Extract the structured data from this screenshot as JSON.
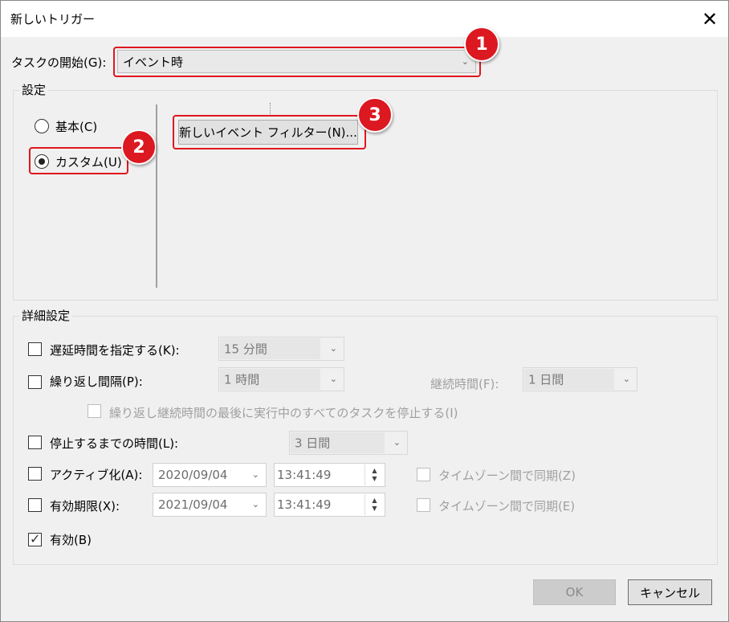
{
  "window": {
    "title": "新しいトリガー",
    "close_glyph": "✕"
  },
  "task_start": {
    "label": "タスクの開始(G):",
    "value": "イベント時",
    "arrow": "⌄"
  },
  "settings": {
    "group_title": "設定",
    "radio_basic": "基本(C)",
    "radio_custom": "カスタム(U)",
    "selected": "custom",
    "filter_button": "新しいイベント フィルター(N)..."
  },
  "advanced": {
    "group_title": "詳細設定",
    "delay": {
      "label": "遅延時間を指定する(K):",
      "value": "15 分間",
      "checked": false
    },
    "repeat": {
      "label": "繰り返し間隔(P):",
      "value": "1 時間",
      "checked": false
    },
    "duration": {
      "label": "継続時間(F):",
      "value": "1 日間"
    },
    "stop_all": {
      "label": "繰り返し継続時間の最後に実行中のすべてのタスクを停止する(I)",
      "checked": false
    },
    "stop_after": {
      "label": "停止するまでの時間(L):",
      "value": "3 日間",
      "checked": false
    },
    "activate": {
      "label": "アクティブ化(A):",
      "date": "2020/09/04",
      "time": "13:41:49",
      "sync_label": "タイムゾーン間で同期(Z)",
      "checked": false
    },
    "expire": {
      "label": "有効期限(X):",
      "date": "2021/09/04",
      "time": "13:41:49",
      "sync_label": "タイムゾーン間で同期(E)",
      "checked": false
    },
    "enabled": {
      "label": "有効(B)",
      "checked": true
    }
  },
  "footer": {
    "ok_label": "OK",
    "cancel_label": "キャンセル"
  },
  "annotations": {
    "badge1": "1",
    "badge2": "2",
    "badge3": "3",
    "color": "#dc1820"
  },
  "glyphs": {
    "check": "✓",
    "arrow": "⌄",
    "spin_up": "▲",
    "spin_down": "▼"
  }
}
